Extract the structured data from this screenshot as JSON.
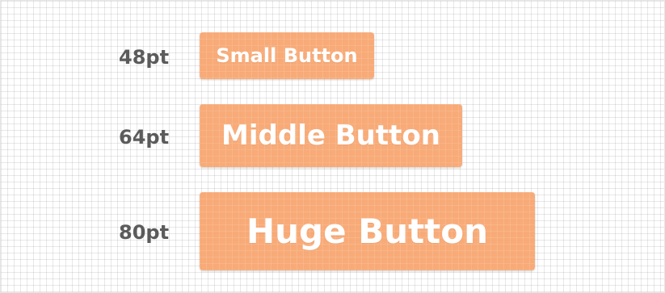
{
  "rows": [
    {
      "size_label": "48pt",
      "button_label": "Small Button"
    },
    {
      "size_label": "64pt",
      "button_label": "Middle Button"
    },
    {
      "size_label": "80pt",
      "button_label": "Huge Button"
    }
  ],
  "colors": {
    "button_fill": "#F7A46C",
    "button_text": "#FFFFFF",
    "label_text": "#5B5B5B",
    "grid_line": "#E6E6E6",
    "background": "#FFFFFF"
  }
}
